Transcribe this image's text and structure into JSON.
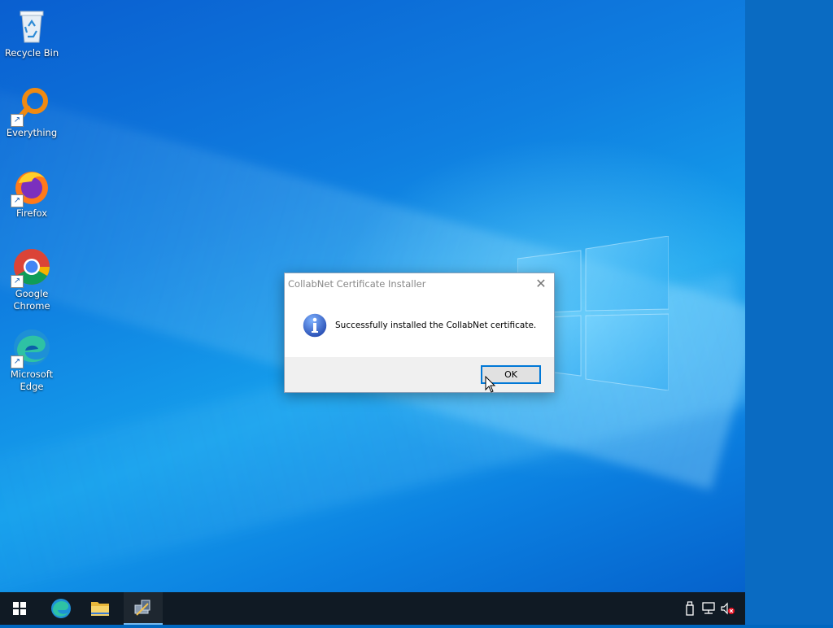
{
  "desktop": {
    "icons": [
      {
        "label": "Recycle Bin",
        "icon": "recycle-bin-icon"
      },
      {
        "label": "Everything",
        "icon": "everything-search-icon"
      },
      {
        "label": "Firefox",
        "icon": "firefox-icon"
      },
      {
        "label": "Google Chrome",
        "icon": "chrome-icon"
      },
      {
        "label": "Microsoft Edge",
        "icon": "edge-icon"
      }
    ]
  },
  "dialog": {
    "title": "CollabNet Certificate Installer",
    "close_glyph": "✕",
    "icon": "info-icon",
    "message": "Successfully installed the CollabNet certificate.",
    "ok_label": "OK"
  },
  "taskbar": {
    "start_icon": "windows-start-icon",
    "pinned": [
      "edge-icon",
      "file-explorer-icon",
      "certificate-installer-icon"
    ],
    "tray": [
      "usb-device-icon",
      "network-icon",
      "volume-muted-icon"
    ]
  },
  "colors": {
    "accent": "#0078d7",
    "taskbar": "#101a24",
    "wallpaper": "#0f7ee0"
  }
}
